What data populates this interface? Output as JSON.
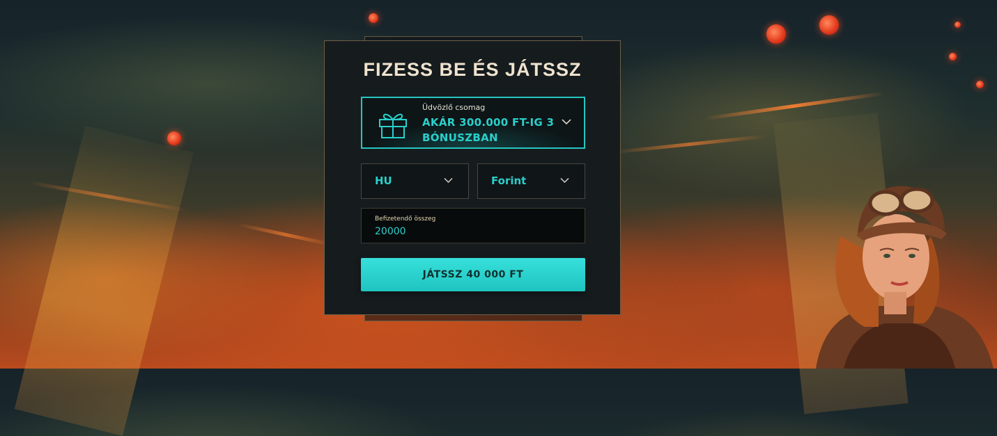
{
  "deposit": {
    "title": "FIZESS BE ÉS JÁTSSZ",
    "promo": {
      "subtitle": "Üdvözlő csomag",
      "offer": "AKÁR 300.000 FT-IG 3 BÓNUSZBAN",
      "icon": "gift-icon"
    },
    "country_select": {
      "value": "HU",
      "icon": "chevron-down-icon"
    },
    "currency_select": {
      "value": "Forint",
      "icon": "chevron-down-icon"
    },
    "amount": {
      "label": "Befizetendő összeg",
      "value": "20000"
    },
    "play_button": {
      "label": "JÁTSSZ 40 000 FT"
    }
  },
  "colors": {
    "accent": "#27c6c2",
    "card_bg": "#161c1e",
    "title_text": "#f0e3cf",
    "card_border": "#6e5f46"
  }
}
